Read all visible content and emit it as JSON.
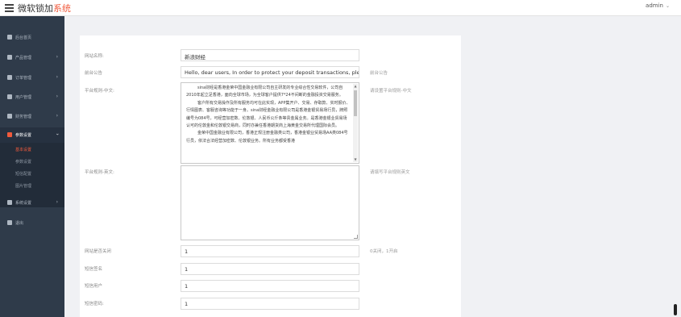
{
  "header": {
    "title_main": "微软锁加",
    "title_accent": "系统",
    "user": "admin",
    "user_caret": "⌄"
  },
  "sidebar": {
    "items": [
      {
        "label": "后台首页"
      },
      {
        "label": "产品管理"
      },
      {
        "label": "订单管理"
      },
      {
        "label": "用户管理"
      },
      {
        "label": "财务管理"
      },
      {
        "label": "参数设置"
      },
      {
        "label": "系统设置"
      },
      {
        "label": "退出"
      }
    ],
    "submenu": [
      {
        "label": "基本设置"
      },
      {
        "label": "参数设置"
      },
      {
        "label": "短信配置"
      },
      {
        "label": "图片管理"
      }
    ]
  },
  "form": {
    "site_name": {
      "label": "网站名称:",
      "value": "新浪财经"
    },
    "notice": {
      "label": "前台公告",
      "value": "Hello, dear users, In order to protect your deposit transactions, please cc",
      "hint": "前台公告"
    },
    "rules_cn": {
      "label": "平台规则-中文:",
      "hint": "请设置平台规则-中文",
      "paragraphs": [
        "sina财经是香港金荣中国金融业有限公司自主研发的专业综合性交易软件，公司自2010年起立足香港，面向全球市场，为全球客户提供7*24不间断的金融投资交易服务。",
        "客户所有交易操作及所有服务均可在此实现，APP集开户、交易、存取款、实时报价、行情图表、客服咨询等功能于一身。sina财经金融业有限公司是香港金银贸易场行员，牌照编号为084号，可经营加密数、伦敦银、人民币公斤条等贵金属业务。是香港金银业贸易场认可的伦敦金和伦敦银交易商，同时亦兼任香港期货商上海黄金交易所代理国际会员。",
        "金荣中国金融业有限公司，香港正规注册金融类公司，香港金银业贸易场AA类084号行员，依法合法经营加密数、伦敦银业务。所有业务都受香港"
      ]
    },
    "rules_en": {
      "label": "平台规则-英文:",
      "hint": "请填写平台规则英文"
    },
    "site_close": {
      "label": "网站是否关闭",
      "value": "1",
      "hint": "0关闭，1开启"
    },
    "sms_sign": {
      "label": "短信签名",
      "value": "1"
    },
    "sms_user": {
      "label": "短信用户",
      "value": "1"
    },
    "sms_pass": {
      "label": "短信密码:",
      "value": "1"
    }
  },
  "colors": {
    "accent": "#f05a3c",
    "sidebar_bg": "#2f3b4a"
  }
}
